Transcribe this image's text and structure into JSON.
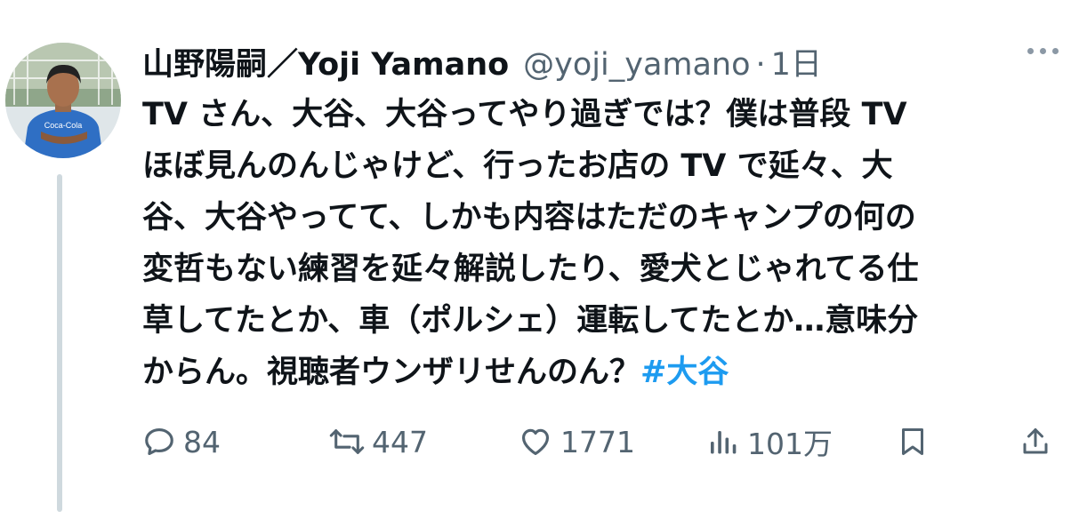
{
  "tweet": {
    "display_name": "山野陽嗣／Yoji Yamano",
    "handle": "@yoji_yamano",
    "separator": "·",
    "time": "1日",
    "body_lines": [
      "TV さん、大谷、大谷ってやり過ぎでは？僕は普段 TV",
      "ほぼ見んのんじゃけど、行ったお店の TV で延々、大",
      "谷、大谷やってて、しかも内容はただのキャンプの何の",
      "変哲もない練習を延々解説したり、愛犬とじゃれてる仕",
      "草してたとか、車（ポルシェ）運転してたとか…意味分"
    ],
    "last_line_text": "からん。視聴者ウンザリせんのん？",
    "hashtag": "#大谷"
  },
  "actions": {
    "reply": {
      "icon": "reply-icon",
      "count": "84"
    },
    "retweet": {
      "icon": "retweet-icon",
      "count": "447"
    },
    "like": {
      "icon": "heart-icon",
      "count": "1771"
    },
    "views": {
      "icon": "views-icon",
      "count": "101万"
    },
    "bookmark": {
      "icon": "bookmark-icon"
    },
    "share": {
      "icon": "share-icon"
    }
  },
  "colors": {
    "text": "#0f1419",
    "secondary": "#536471",
    "link": "#1d9bf0",
    "thread_line": "#cfd9de"
  }
}
